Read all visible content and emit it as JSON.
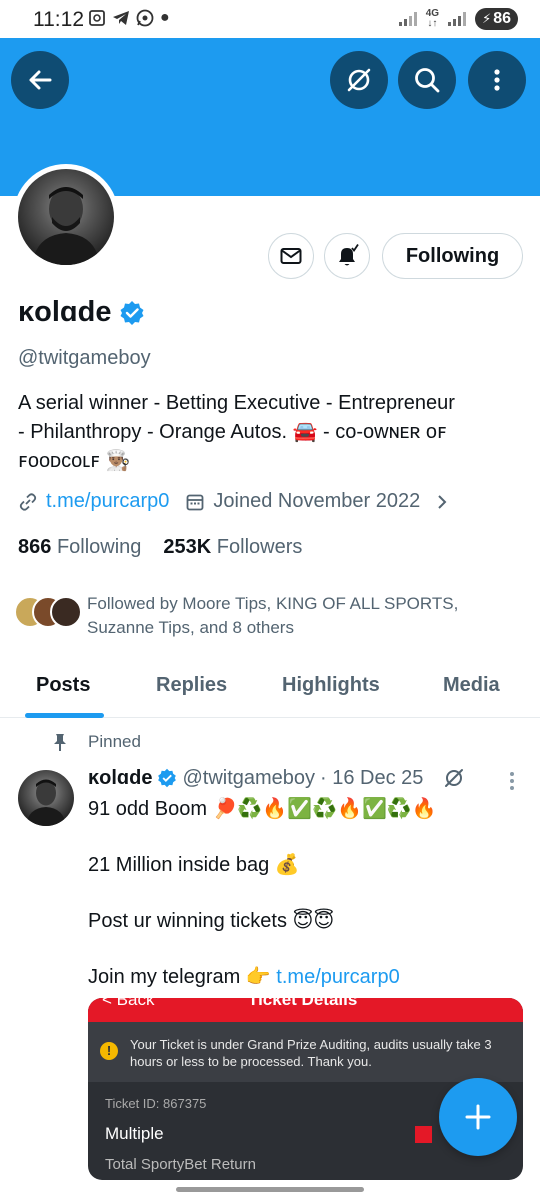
{
  "status_bar": {
    "time": "11:12",
    "network": "4G",
    "battery": "86"
  },
  "profile": {
    "name": "ĸolɑde",
    "handle": "@twitgameboy",
    "bio_line1": "A serial winner  - Betting Executive - Entrepreneur",
    "bio_line2": "- Philanthropy - Orange Autos. 🚘  - ᴄᴏ-ᴏᴡɴᴇʀ ᴏꜰ",
    "bio_line3": "ꜰᴏᴏᴅᴄᴏʟꜰ 👨🏽‍🍳",
    "link": "t.me/purcarp0",
    "joined": "Joined November 2022",
    "following_count": "866",
    "following_label": "Following",
    "followers_count": "253K",
    "followers_label": "Followers",
    "followed_by": "Followed by Moore Tips, KING OF ALL SPORTS, Suzanne Tips, and 8 others",
    "follow_button": "Following"
  },
  "tabs": [
    "Posts",
    "Replies",
    "Highlights",
    "Media"
  ],
  "post": {
    "pinned_label": "Pinned",
    "author": "ĸolɑde",
    "handle": "@twitgameboy",
    "date": "· 16 Dec 25",
    "line1": "91 odd Boom 🏓♻️🔥✅♻️🔥✅♻️🔥",
    "line2": "21 Million inside bag 💰",
    "line3": "Post ur winning tickets 😇😇",
    "line4_text": "Join my telegram 👉",
    "line4_link": "t.me/purcarp0"
  },
  "ticket_image": {
    "back": "< Back",
    "title": "Ticket Details",
    "notice": "Your Ticket is under Grand Prize Auditing, audits usually take 3 hours or less to be processed. Thank you.",
    "ticket_id": "Ticket ID: 867375",
    "bet_type": "Multiple",
    "return_label": "Total SportyBet Return"
  },
  "colors": {
    "brand": "#1d9bf0",
    "banner": "#1d9bf0",
    "header_button": "#0f4c73",
    "text": "#0f1419",
    "muted": "#536471"
  }
}
